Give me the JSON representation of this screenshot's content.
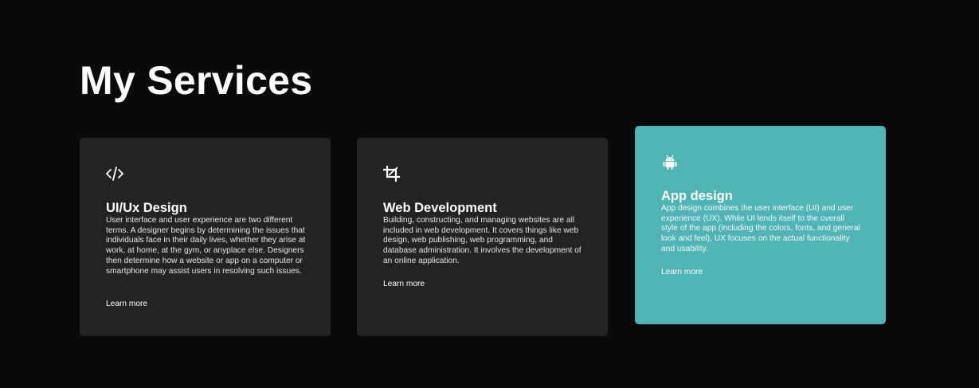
{
  "heading": "My Services",
  "colors": {
    "background": "#0b0a0b",
    "card": "#232323",
    "card_highlight": "#50b3b4",
    "text": "#ffffff"
  },
  "services": [
    {
      "icon": "code-icon",
      "title": "UI/Ux Design",
      "description": "User interface and user experience are two different terms. A designer begins by determining the issues that individuals face in their daily lives, whether they arise at work, at home, at the gym, or anyplace else. Designers then determine how a website or app on a computer or smartphone may assist users in resolving such issues.",
      "link": "Learn more"
    },
    {
      "icon": "crop-icon",
      "title": "Web Development",
      "description": "Building, constructing, and managing websites are all included in web development. It covers things like web design, web publishing, web programming, and database administration. It involves the development of an online application.",
      "link": "Learn more"
    },
    {
      "icon": "android-icon",
      "title": "App design",
      "description": "App design combines the user interface (UI) and user experience (UX). While UI lends itself to the overall style of the app (including the colors, fonts, and general look and feel), UX focuses on the actual functionality and usability.",
      "link": "Learn more"
    }
  ]
}
